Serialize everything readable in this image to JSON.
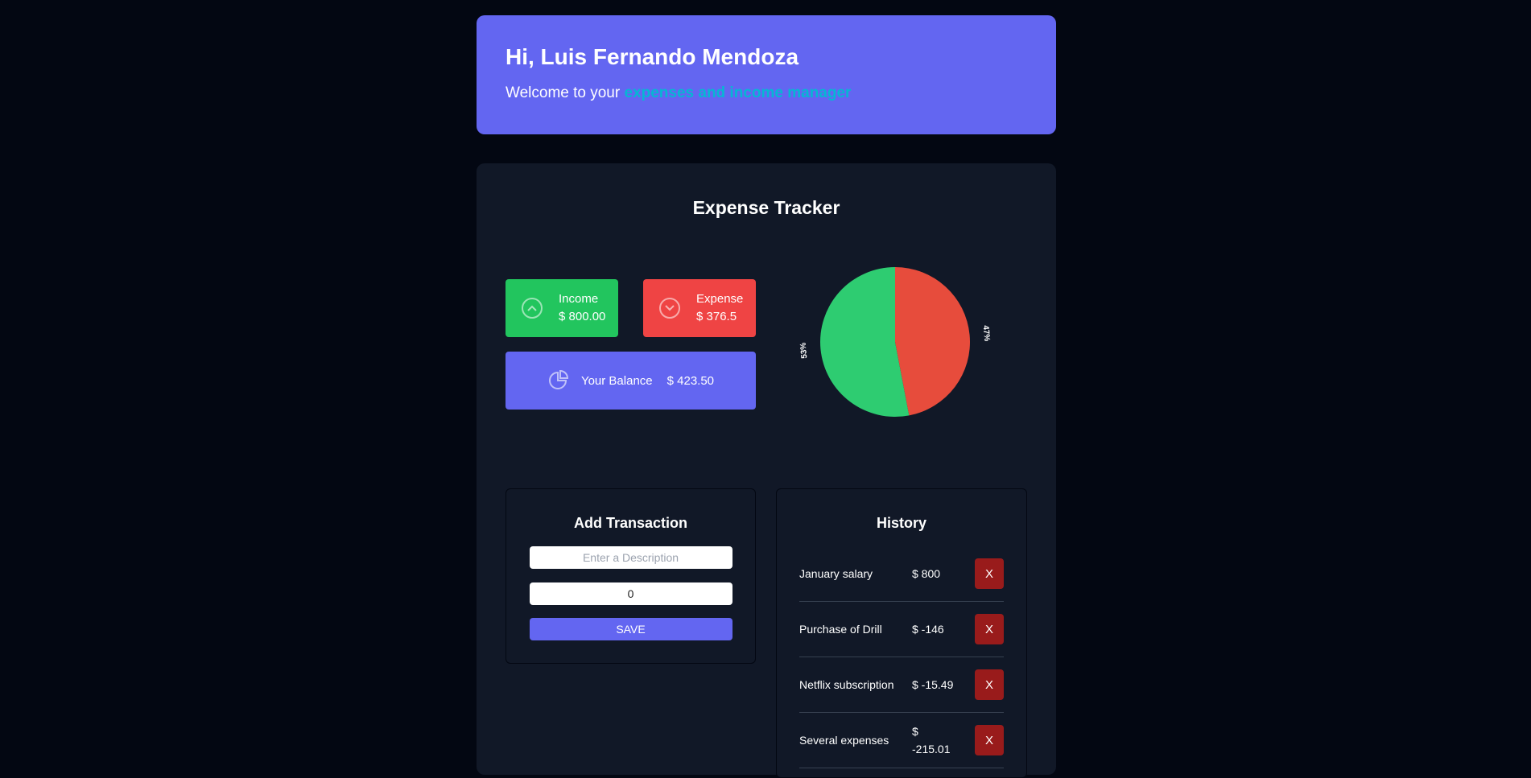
{
  "header": {
    "greeting": "Hi, Luis Fernando Mendoza",
    "welcome_prefix": "Welcome to your ",
    "welcome_accent": "expenses and income manager"
  },
  "tracker": {
    "title": "Expense Tracker",
    "income": {
      "label": "Income",
      "value": "$ 800.00",
      "icon": "chevron-up-circle-icon"
    },
    "expense": {
      "label": "Expense",
      "value": "$ 376.5",
      "icon": "chevron-down-circle-icon"
    },
    "balance": {
      "label": "Your Balance",
      "value": "$ 423.50",
      "icon": "pie-chart-icon"
    }
  },
  "chart_data": {
    "type": "pie",
    "title": "",
    "slices": [
      {
        "label": "53%",
        "value": 53,
        "color": "#2ecc71"
      },
      {
        "label": "47%",
        "value": 47,
        "color": "#e74c3c"
      }
    ]
  },
  "add_transaction": {
    "title": "Add Transaction",
    "description_placeholder": "Enter a Description",
    "amount_value": "0",
    "save_label": "SAVE"
  },
  "history": {
    "title": "History",
    "delete_label": "X",
    "items": [
      {
        "description": "January salary",
        "amount": "$ 800"
      },
      {
        "description": "Purchase of Drill",
        "amount": "$ -146"
      },
      {
        "description": "Netflix subscription",
        "amount": "$ -15.49"
      },
      {
        "description": "Several expenses",
        "amount": "$ -215.01"
      }
    ]
  },
  "colors": {
    "page_bg": "#030712",
    "panel_bg": "#111827",
    "accent": "#6366f1",
    "income": "#22c55e",
    "expense": "#ef4444",
    "delete": "#991b1b",
    "highlight": "#06b6d4"
  }
}
